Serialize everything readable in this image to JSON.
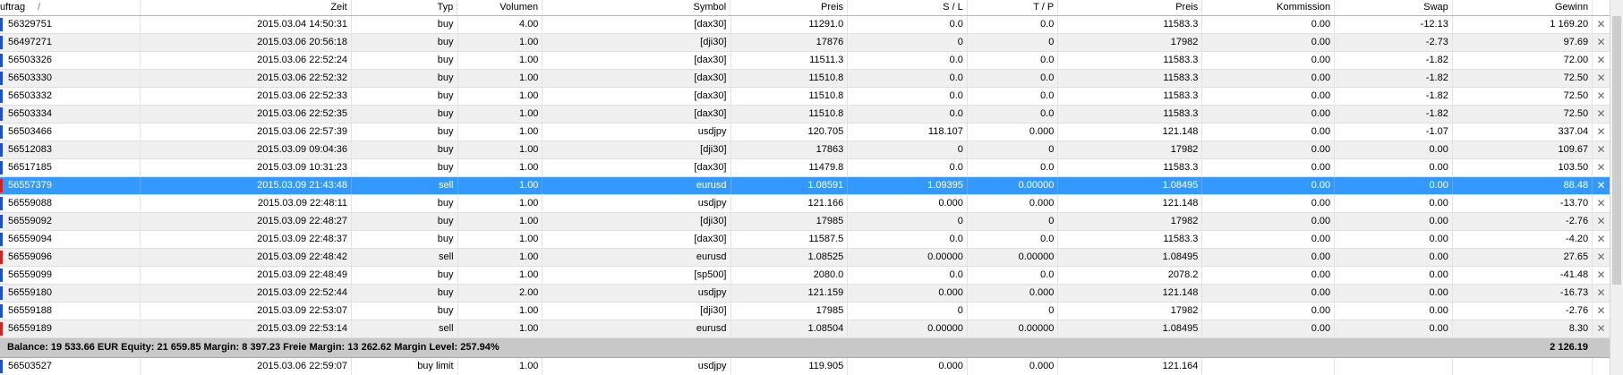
{
  "columns": {
    "order": "uftrag",
    "sort_indicator": "/",
    "time": "Zeit",
    "type": "Typ",
    "volume": "Volumen",
    "symbol": "Symbol",
    "price": "Preis",
    "sl": "S / L",
    "tp": "T / P",
    "price2": "Preis",
    "commission": "Kommission",
    "swap": "Swap",
    "profit": "Gewinn"
  },
  "icons": {
    "close": "✕"
  },
  "rows": [
    {
      "order": "56329751",
      "time": "2015.03.04 14:50:31",
      "type": "buy",
      "volume": "4.00",
      "symbol": "[dax30]",
      "price": "11291.0",
      "sl": "0.0",
      "tp": "0.0",
      "price2": "11583.3",
      "commission": "0.00",
      "swap": "-12.13",
      "profit": "1 169.20"
    },
    {
      "order": "56497271",
      "time": "2015.03.06 20:56:18",
      "type": "buy",
      "volume": "1.00",
      "symbol": "[dji30]",
      "price": "17876",
      "sl": "0",
      "tp": "0",
      "price2": "17982",
      "commission": "0.00",
      "swap": "-2.73",
      "profit": "97.69"
    },
    {
      "order": "56503326",
      "time": "2015.03.06 22:52:24",
      "type": "buy",
      "volume": "1.00",
      "symbol": "[dax30]",
      "price": "11511.3",
      "sl": "0.0",
      "tp": "0.0",
      "price2": "11583.3",
      "commission": "0.00",
      "swap": "-1.82",
      "profit": "72.00"
    },
    {
      "order": "56503330",
      "time": "2015.03.06 22:52:32",
      "type": "buy",
      "volume": "1.00",
      "symbol": "[dax30]",
      "price": "11510.8",
      "sl": "0.0",
      "tp": "0.0",
      "price2": "11583.3",
      "commission": "0.00",
      "swap": "-1.82",
      "profit": "72.50"
    },
    {
      "order": "56503332",
      "time": "2015.03.06 22:52:33",
      "type": "buy",
      "volume": "1.00",
      "symbol": "[dax30]",
      "price": "11510.8",
      "sl": "0.0",
      "tp": "0.0",
      "price2": "11583.3",
      "commission": "0.00",
      "swap": "-1.82",
      "profit": "72.50"
    },
    {
      "order": "56503334",
      "time": "2015.03.06 22:52:35",
      "type": "buy",
      "volume": "1.00",
      "symbol": "[dax30]",
      "price": "11510.8",
      "sl": "0.0",
      "tp": "0.0",
      "price2": "11583.3",
      "commission": "0.00",
      "swap": "-1.82",
      "profit": "72.50"
    },
    {
      "order": "56503466",
      "time": "2015.03.06 22:57:39",
      "type": "buy",
      "volume": "1.00",
      "symbol": "usdjpy",
      "price": "120.705",
      "sl": "118.107",
      "tp": "0.000",
      "price2": "121.148",
      "commission": "0.00",
      "swap": "-1.07",
      "profit": "337.04"
    },
    {
      "order": "56512083",
      "time": "2015.03.09 09:04:36",
      "type": "buy",
      "volume": "1.00",
      "symbol": "[dji30]",
      "price": "17863",
      "sl": "0",
      "tp": "0",
      "price2": "17982",
      "commission": "0.00",
      "swap": "0.00",
      "profit": "109.67"
    },
    {
      "order": "56517185",
      "time": "2015.03.09 10:31:23",
      "type": "buy",
      "volume": "1.00",
      "symbol": "[dax30]",
      "price": "11479.8",
      "sl": "0.0",
      "tp": "0.0",
      "price2": "11583.3",
      "commission": "0.00",
      "swap": "0.00",
      "profit": "103.50"
    },
    {
      "order": "56557379",
      "time": "2015.03.09 21:43:48",
      "type": "sell",
      "volume": "1.00",
      "symbol": "eurusd",
      "price": "1.08591",
      "sl": "1.09395",
      "tp": "0.00000",
      "price2": "1.08495",
      "commission": "0.00",
      "swap": "0.00",
      "profit": "88.48"
    },
    {
      "order": "56559088",
      "time": "2015.03.09 22:48:11",
      "type": "buy",
      "volume": "1.00",
      "symbol": "usdjpy",
      "price": "121.166",
      "sl": "0.000",
      "tp": "0.000",
      "price2": "121.148",
      "commission": "0.00",
      "swap": "0.00",
      "profit": "-13.70"
    },
    {
      "order": "56559092",
      "time": "2015.03.09 22:48:27",
      "type": "buy",
      "volume": "1.00",
      "symbol": "[dji30]",
      "price": "17985",
      "sl": "0",
      "tp": "0",
      "price2": "17982",
      "commission": "0.00",
      "swap": "0.00",
      "profit": "-2.76"
    },
    {
      "order": "56559094",
      "time": "2015.03.09 22:48:37",
      "type": "buy",
      "volume": "1.00",
      "symbol": "[dax30]",
      "price": "11587.5",
      "sl": "0.0",
      "tp": "0.0",
      "price2": "11583.3",
      "commission": "0.00",
      "swap": "0.00",
      "profit": "-4.20"
    },
    {
      "order": "56559096",
      "time": "2015.03.09 22:48:42",
      "type": "sell",
      "volume": "1.00",
      "symbol": "eurusd",
      "price": "1.08525",
      "sl": "0.00000",
      "tp": "0.00000",
      "price2": "1.08495",
      "commission": "0.00",
      "swap": "0.00",
      "profit": "27.65"
    },
    {
      "order": "56559099",
      "time": "2015.03.09 22:48:49",
      "type": "buy",
      "volume": "1.00",
      "symbol": "[sp500]",
      "price": "2080.0",
      "sl": "0.0",
      "tp": "0.0",
      "price2": "2078.2",
      "commission": "0.00",
      "swap": "0.00",
      "profit": "-41.48"
    },
    {
      "order": "56559180",
      "time": "2015.03.09 22:52:44",
      "type": "buy",
      "volume": "2.00",
      "symbol": "usdjpy",
      "price": "121.159",
      "sl": "0.000",
      "tp": "0.000",
      "price2": "121.148",
      "commission": "0.00",
      "swap": "0.00",
      "profit": "-16.73"
    },
    {
      "order": "56559188",
      "time": "2015.03.09 22:53:07",
      "type": "buy",
      "volume": "1.00",
      "symbol": "[dji30]",
      "price": "17985",
      "sl": "0",
      "tp": "0",
      "price2": "17982",
      "commission": "0.00",
      "swap": "0.00",
      "profit": "-2.76"
    },
    {
      "order": "56559189",
      "time": "2015.03.09 22:53:14",
      "type": "sell",
      "volume": "1.00",
      "symbol": "eurusd",
      "price": "1.08504",
      "sl": "0.00000",
      "tp": "0.00000",
      "price2": "1.08495",
      "commission": "0.00",
      "swap": "0.00",
      "profit": "8.30"
    }
  ],
  "selected_order": "56557379",
  "summary": {
    "text": "Balance: 19 533.66 EUR  Equity: 21 659.85  Margin: 8 397.23  Freie Margin: 13 262.62  Margin Level: 257.94%",
    "total_profit": "2 126.19"
  },
  "pending": [
    {
      "order": "56503527",
      "time": "2015.03.06 22:59:07",
      "type": "buy limit",
      "volume": "1.00",
      "symbol": "usdjpy",
      "price": "119.905",
      "sl": "0.000",
      "tp": "0.000",
      "price2": "121.164",
      "commission": "",
      "swap": "",
      "profit": ""
    }
  ],
  "colors": {
    "selected_row": "#3399ff",
    "alt_row": "#f0f0f0",
    "summary_row": "#c8c8c8",
    "buy_marker": "#1c4fd6",
    "sell_marker": "#d62020"
  }
}
